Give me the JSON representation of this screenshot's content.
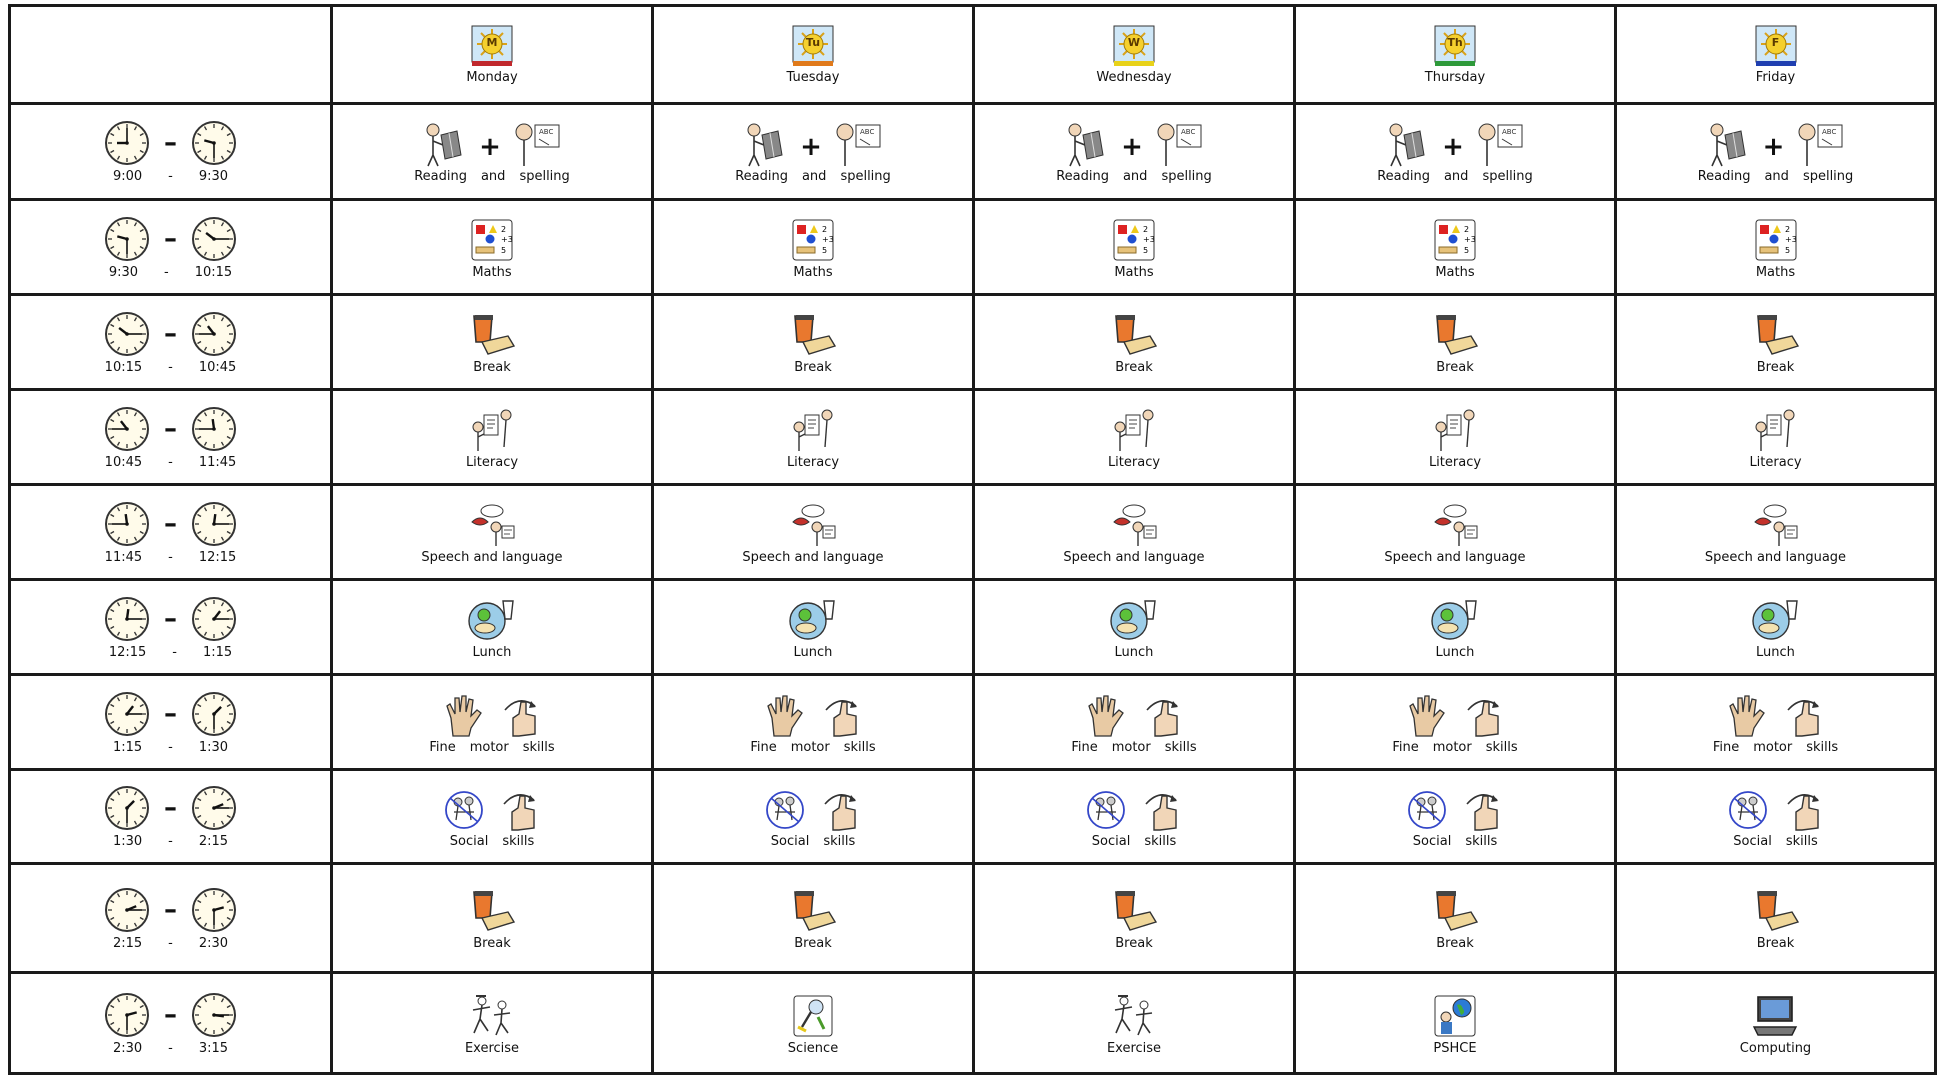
{
  "days": [
    {
      "label": "Monday",
      "letter": "M",
      "bar": "#c0282d"
    },
    {
      "label": "Tuesday",
      "letter": "Tu",
      "bar": "#e07a1b"
    },
    {
      "label": "Wednesday",
      "letter": "W",
      "bar": "#e8d21a"
    },
    {
      "label": "Thursday",
      "letter": "Th",
      "bar": "#2e9a3a"
    },
    {
      "label": "Friday",
      "letter": "F",
      "bar": "#1f3fb0"
    }
  ],
  "times": [
    {
      "start": "9:00",
      "sep": "-",
      "end": "9:30"
    },
    {
      "start": "9:30",
      "sep": "-",
      "end": "10:15"
    },
    {
      "start": "10:15",
      "sep": "-",
      "end": "10:45"
    },
    {
      "start": "10:45",
      "sep": "-",
      "end": "11:45"
    },
    {
      "start": "11:45",
      "sep": "-",
      "end": "12:15"
    },
    {
      "start": "12:15",
      "sep": "-",
      "end": "1:15"
    },
    {
      "start": "1:15",
      "sep": "-",
      "end": "1:30"
    },
    {
      "start": "1:30",
      "sep": "-",
      "end": "2:15"
    },
    {
      "start": "2:15",
      "sep": "-",
      "end": "2:30"
    },
    {
      "start": "2:30",
      "sep": "-",
      "end": "3:15"
    }
  ],
  "rows": [
    [
      {
        "icons": [
          "reading-icon",
          "plus-icon",
          "spelling-icon"
        ],
        "words": [
          "Reading",
          "and",
          "spelling"
        ]
      },
      {
        "icons": [
          "reading-icon",
          "plus-icon",
          "spelling-icon"
        ],
        "words": [
          "Reading",
          "and",
          "spelling"
        ]
      },
      {
        "icons": [
          "reading-icon",
          "plus-icon",
          "spelling-icon"
        ],
        "words": [
          "Reading",
          "and",
          "spelling"
        ]
      },
      {
        "icons": [
          "reading-icon",
          "plus-icon",
          "spelling-icon"
        ],
        "words": [
          "Reading",
          "and",
          "spelling"
        ]
      },
      {
        "icons": [
          "reading-icon",
          "plus-icon",
          "spelling-icon"
        ],
        "words": [
          "Reading",
          "and",
          "spelling"
        ]
      }
    ],
    [
      {
        "icons": [
          "maths-icon"
        ],
        "words": [
          "Maths"
        ]
      },
      {
        "icons": [
          "maths-icon"
        ],
        "words": [
          "Maths"
        ]
      },
      {
        "icons": [
          "maths-icon"
        ],
        "words": [
          "Maths"
        ]
      },
      {
        "icons": [
          "maths-icon"
        ],
        "words": [
          "Maths"
        ]
      },
      {
        "icons": [
          "maths-icon"
        ],
        "words": [
          "Maths"
        ]
      }
    ],
    [
      {
        "icons": [
          "break-snack-icon"
        ],
        "words": [
          "Break"
        ]
      },
      {
        "icons": [
          "break-snack-icon"
        ],
        "words": [
          "Break"
        ]
      },
      {
        "icons": [
          "break-snack-icon"
        ],
        "words": [
          "Break"
        ]
      },
      {
        "icons": [
          "break-snack-icon"
        ],
        "words": [
          "Break"
        ]
      },
      {
        "icons": [
          "break-snack-icon"
        ],
        "words": [
          "Break"
        ]
      }
    ],
    [
      {
        "icons": [
          "literacy-icon"
        ],
        "words": [
          "Literacy"
        ]
      },
      {
        "icons": [
          "literacy-icon"
        ],
        "words": [
          "Literacy"
        ]
      },
      {
        "icons": [
          "literacy-icon"
        ],
        "words": [
          "Literacy"
        ]
      },
      {
        "icons": [
          "literacy-icon"
        ],
        "words": [
          "Literacy"
        ]
      },
      {
        "icons": [
          "literacy-icon"
        ],
        "words": [
          "Literacy"
        ]
      }
    ],
    [
      {
        "icons": [
          "speech-language-icon"
        ],
        "words": [
          "Speech and language"
        ]
      },
      {
        "icons": [
          "speech-language-icon"
        ],
        "words": [
          "Speech and language"
        ]
      },
      {
        "icons": [
          "speech-language-icon"
        ],
        "words": [
          "Speech and language"
        ]
      },
      {
        "icons": [
          "speech-language-icon"
        ],
        "words": [
          "Speech and language"
        ]
      },
      {
        "icons": [
          "speech-language-icon"
        ],
        "words": [
          "Speech and language"
        ]
      }
    ],
    [
      {
        "icons": [
          "lunch-icon"
        ],
        "words": [
          "Lunch"
        ]
      },
      {
        "icons": [
          "lunch-icon"
        ],
        "words": [
          "Lunch"
        ]
      },
      {
        "icons": [
          "lunch-icon"
        ],
        "words": [
          "Lunch"
        ]
      },
      {
        "icons": [
          "lunch-icon"
        ],
        "words": [
          "Lunch"
        ]
      },
      {
        "icons": [
          "lunch-icon"
        ],
        "words": [
          "Lunch"
        ]
      }
    ],
    [
      {
        "icons": [
          "hand-icon",
          "thumbs-up-icon"
        ],
        "words": [
          "Fine",
          "motor",
          "skills"
        ]
      },
      {
        "icons": [
          "hand-icon",
          "thumbs-up-icon"
        ],
        "words": [
          "Fine",
          "motor",
          "skills"
        ]
      },
      {
        "icons": [
          "hand-icon",
          "thumbs-up-icon"
        ],
        "words": [
          "Fine",
          "motor",
          "skills"
        ]
      },
      {
        "icons": [
          "hand-icon",
          "thumbs-up-icon"
        ],
        "words": [
          "Fine",
          "motor",
          "skills"
        ]
      },
      {
        "icons": [
          "hand-icon",
          "thumbs-up-icon"
        ],
        "words": [
          "Fine",
          "motor",
          "skills"
        ]
      }
    ],
    [
      {
        "icons": [
          "social-icon",
          "thumbs-up-icon"
        ],
        "words": [
          "Social",
          "skills"
        ]
      },
      {
        "icons": [
          "social-icon",
          "thumbs-up-icon"
        ],
        "words": [
          "Social",
          "skills"
        ]
      },
      {
        "icons": [
          "social-icon",
          "thumbs-up-icon"
        ],
        "words": [
          "Social",
          "skills"
        ]
      },
      {
        "icons": [
          "social-icon",
          "thumbs-up-icon"
        ],
        "words": [
          "Social",
          "skills"
        ]
      },
      {
        "icons": [
          "social-icon",
          "thumbs-up-icon"
        ],
        "words": [
          "Social",
          "skills"
        ]
      }
    ],
    [
      {
        "icons": [
          "break-snack-icon"
        ],
        "words": [
          "Break"
        ]
      },
      {
        "icons": [
          "break-snack-icon"
        ],
        "words": [
          "Break"
        ]
      },
      {
        "icons": [
          "break-snack-icon"
        ],
        "words": [
          "Break"
        ]
      },
      {
        "icons": [
          "break-snack-icon"
        ],
        "words": [
          "Break"
        ]
      },
      {
        "icons": [
          "break-snack-icon"
        ],
        "words": [
          "Break"
        ]
      }
    ],
    [
      {
        "icons": [
          "exercise-icon"
        ],
        "words": [
          "Exercise"
        ]
      },
      {
        "icons": [
          "science-icon"
        ],
        "words": [
          "Science"
        ]
      },
      {
        "icons": [
          "exercise-icon"
        ],
        "words": [
          "Exercise"
        ]
      },
      {
        "icons": [
          "pshce-icon"
        ],
        "words": [
          "PSHCE"
        ]
      },
      {
        "icons": [
          "computer-icon"
        ],
        "words": [
          "Computing"
        ]
      }
    ]
  ]
}
